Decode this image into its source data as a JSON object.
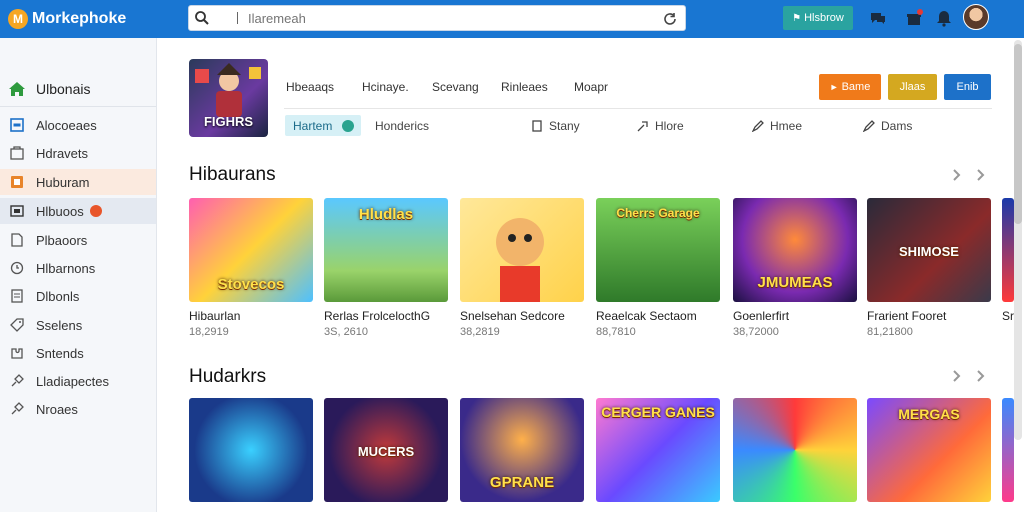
{
  "app": {
    "name": "Morkephoke",
    "logo_letter": "M"
  },
  "search": {
    "placeholder": "Ilaremeah"
  },
  "topbar": {
    "button_label": "Hlsbrow"
  },
  "sidebar": {
    "home_label": "Ulbonais",
    "items": [
      {
        "label": "Alocoeaes",
        "icon": "square-icon"
      },
      {
        "label": "Hdravets",
        "icon": "folder-icon"
      },
      {
        "label": "Huburam",
        "icon": "badge-icon"
      },
      {
        "label": "Hlbuoos",
        "icon": "monitor-icon"
      },
      {
        "label": "Plbaoors",
        "icon": "page-icon"
      },
      {
        "label": "Hlbarnons",
        "icon": "clock-icon"
      },
      {
        "label": "Dlbonls",
        "icon": "doc-icon"
      },
      {
        "label": "Sselens",
        "icon": "tag-icon"
      },
      {
        "label": "Sntends",
        "icon": "puzzle-icon"
      },
      {
        "label": "Lladiapectes",
        "icon": "link-icon"
      },
      {
        "label": "Nroaes",
        "icon": "pin-icon"
      }
    ]
  },
  "header": {
    "thumb_label": "FIGHRS",
    "tabs": [
      "Hbeaaqs",
      "Hcinaye.",
      "Scevang",
      "Rinleaes",
      "Moapr"
    ],
    "actions": [
      {
        "label": "Bame",
        "color": "#f07a1a"
      },
      {
        "label": "Jlaas",
        "color": "#d4a820"
      },
      {
        "label": "Enib",
        "color": "#1d71c9"
      }
    ],
    "pill_label": "Hartem",
    "subtabs": [
      {
        "label": "Honderics",
        "icon": ""
      },
      {
        "label": "Stany",
        "icon": "bookmark-icon"
      },
      {
        "label": "Hlore",
        "icon": "share-icon"
      },
      {
        "label": "Hmee",
        "icon": "pencil-icon"
      },
      {
        "label": "Dams",
        "icon": "edit-icon"
      }
    ]
  },
  "sections": [
    {
      "title": "Hibaurans",
      "cards": [
        {
          "title": "Hibaurlan",
          "meta": "18,2919",
          "label": "Stovecos"
        },
        {
          "title": "Rerlas FrolcelocthG",
          "meta": "3S, 2610",
          "label": "Hludlas"
        },
        {
          "title": "Snelsehan Sedcore",
          "meta": "38,2819",
          "label": ""
        },
        {
          "title": "Reaelcak Sectaom",
          "meta": "88,7810",
          "label": "Cherrs Garage"
        },
        {
          "title": "Goenlerfirt",
          "meta": "38,72000",
          "label": "JMUMEAS"
        },
        {
          "title": "Frarient Fooret",
          "meta": "81,21800",
          "label": "SHIMOSE"
        },
        {
          "title": "Sr",
          "meta": "",
          "label": ""
        }
      ]
    },
    {
      "title": "Hudarkrs",
      "cards": [
        {
          "title": "",
          "meta": "",
          "label": ""
        },
        {
          "title": "",
          "meta": "",
          "label": "MUCERS"
        },
        {
          "title": "",
          "meta": "",
          "label": "GPRANE"
        },
        {
          "title": "",
          "meta": "",
          "label": "CERGER GANES"
        },
        {
          "title": "",
          "meta": "",
          "label": ""
        },
        {
          "title": "",
          "meta": "",
          "label": "MERGAS"
        },
        {
          "title": "",
          "meta": "",
          "label": ""
        }
      ]
    }
  ],
  "colors": {
    "topbar": "#1976d2",
    "accent_teal": "#2aa3a0",
    "sidebar_bg": "#f5f7fa",
    "active_orange": "#fbeadf",
    "active_blue": "#e4e9f1",
    "home_green": "#2e9a3e"
  }
}
